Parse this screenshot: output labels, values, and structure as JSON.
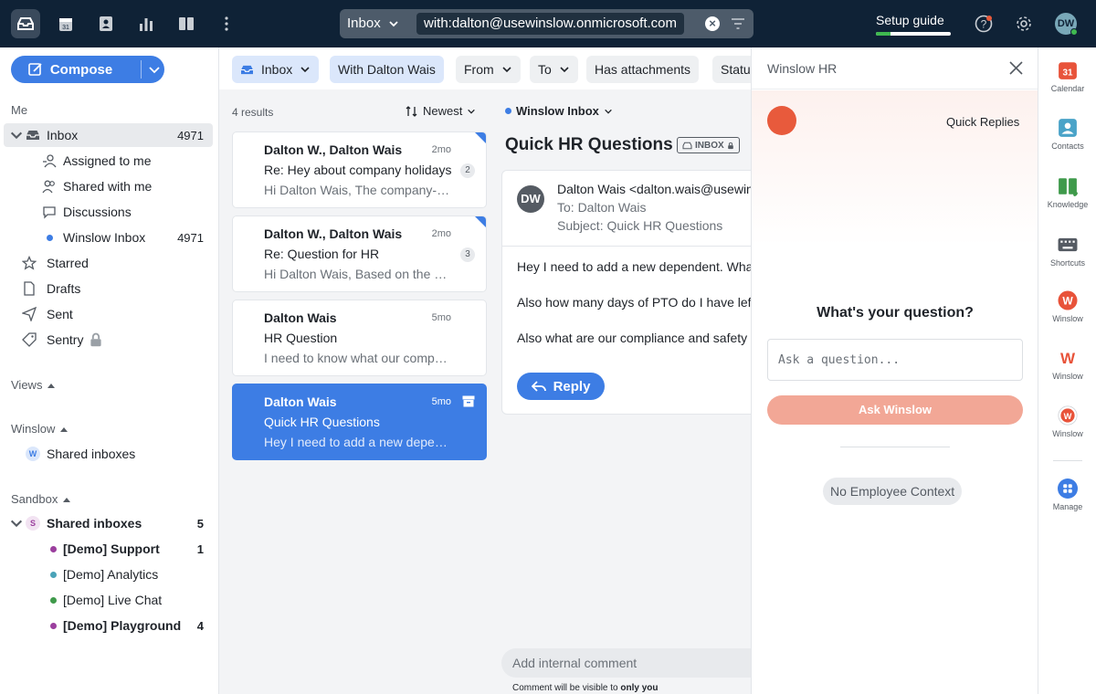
{
  "topbar": {
    "search_scope": "Inbox",
    "search_query": "with:dalton@usewinslow.onmicrosoft.com",
    "setup_label": "Setup guide",
    "setup_progress": 0.2,
    "avatar_initials": "DW"
  },
  "sidebar": {
    "compose_label": "Compose",
    "me_label": "Me",
    "inbox": {
      "label": "Inbox",
      "count": "4971"
    },
    "sub_items": [
      {
        "label": "Assigned to me"
      },
      {
        "label": "Shared with me"
      },
      {
        "label": "Discussions"
      },
      {
        "label": "Winslow Inbox",
        "count": "4971"
      }
    ],
    "folders": [
      {
        "label": "Starred"
      },
      {
        "label": "Drafts"
      },
      {
        "label": "Sent"
      },
      {
        "label": "Sentry"
      }
    ],
    "views_label": "Views",
    "winslow_label": "Winslow",
    "winslow_shared": "Shared inboxes",
    "sandbox_label": "Sandbox",
    "sandbox_shared": {
      "label": "Shared inboxes",
      "count": "5"
    },
    "sandbox_items": [
      {
        "label": "[Demo] Support",
        "count": "1",
        "color": "#9b3f9e"
      },
      {
        "label": "[Demo] Analytics",
        "count": "",
        "color": "#4aa3b8"
      },
      {
        "label": "[Demo] Live Chat",
        "count": "",
        "color": "#3f9a4b"
      },
      {
        "label": "[Demo] Playground",
        "count": "4",
        "color": "#9b3f9e"
      }
    ]
  },
  "filters": {
    "inbox": "Inbox",
    "with": "With Dalton Wais",
    "from": "From",
    "to": "To",
    "attachments": "Has attachments",
    "status": "Status"
  },
  "list": {
    "results": "4 results",
    "sort": "Newest",
    "cards": [
      {
        "from": "Dalton W., Dalton Wais",
        "time": "2mo",
        "subject": "Re: Hey about company holidays",
        "preview": "Hi Dalton Wais, The company-wide",
        "count": "2"
      },
      {
        "from": "Dalton W., Dalton Wais",
        "time": "2mo",
        "subject": "Re: Question for HR",
        "preview": "Hi Dalton Wais, Based on the policy",
        "count": "3"
      },
      {
        "from": "Dalton Wais",
        "time": "5mo",
        "subject": "HR Question",
        "preview": "I need to know what our company",
        "count": ""
      },
      {
        "from": "Dalton Wais",
        "time": "5mo",
        "subject": "Quick HR Questions",
        "preview": "Hey I need to add a new dependent",
        "count": ""
      }
    ]
  },
  "message": {
    "inbox_name": "Winslow Inbox",
    "title": "Quick HR Questions",
    "tag": "INBOX",
    "avatar": "DW",
    "from": "Dalton Wais <dalton.wais@usewinslow.onmicrosoft.com>",
    "to": "To: Dalton Wais",
    "subject": "Subject: Quick HR Questions",
    "body": [
      "Hey I need to add a new dependent.  What do I need to do?",
      "Also how many days of PTO do I have left?",
      "Also what are our compliance and safety policies?"
    ],
    "reply_label": "Reply",
    "comment_placeholder": "Add internal comment",
    "comment_note_prefix": "Comment will be visible to ",
    "comment_note_bold": "only you"
  },
  "panel": {
    "title": "Winslow HR",
    "quick_replies": "Quick Replies",
    "question_title": "What's your question?",
    "input_placeholder": "Ask a question...",
    "ask_label": "Ask Winslow",
    "no_context": "No Employee Context",
    "accent": "#e85a3c"
  },
  "rail": [
    {
      "label": "Calendar",
      "icon": "calendar-icon"
    },
    {
      "label": "Contacts",
      "icon": "contacts-icon"
    },
    {
      "label": "Knowledge",
      "icon": "knowledge-icon"
    },
    {
      "label": "Shortcuts",
      "icon": "keyboard-icon"
    },
    {
      "label": "Winslow",
      "icon": "winslow-icon"
    },
    {
      "label": "Winslow",
      "icon": "winslow-icon"
    },
    {
      "label": "Winslow",
      "icon": "winslow-icon"
    },
    {
      "label": "Manage",
      "icon": "manage-icon"
    }
  ]
}
